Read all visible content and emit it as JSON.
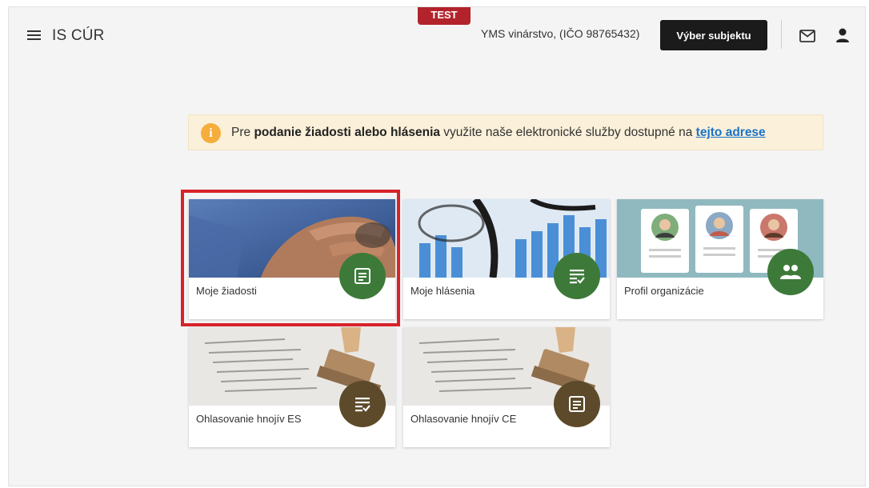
{
  "header": {
    "app_title": "IS CÚR",
    "env_badge": "TEST",
    "organization": "YMS vinárstvo, (IČO 98765432)",
    "select_subject_label": "Výber subjektu",
    "icons": [
      "menu-icon",
      "mail-icon",
      "user-icon"
    ]
  },
  "banner": {
    "text_before": "Pre ",
    "text_bold": "podanie žiadosti alebo hlásenia",
    "text_after": " využite naše elektronické služby dostupné na ",
    "link_text": "tejto adrese",
    "icon": "info-icon"
  },
  "tiles": [
    {
      "label": "Moje žiadosti",
      "icon": "document-icon",
      "fab_color": "#3d7a3a",
      "highlighted": true
    },
    {
      "label": "Moje hlásenia",
      "icon": "checklist-icon",
      "fab_color": "#3d7a3a",
      "highlighted": false
    },
    {
      "label": "Profil organizácie",
      "icon": "people-icon",
      "fab_color": "#3d7a3a",
      "highlighted": false
    },
    {
      "label": "Ohlasovanie hnojív ES",
      "icon": "checklist-icon",
      "fab_color": "#5c4a2a",
      "highlighted": false
    },
    {
      "label": "Ohlasovanie hnojív CE",
      "icon": "document-icon",
      "fab_color": "#5c4a2a",
      "highlighted": false
    }
  ],
  "colors": {
    "highlight_border": "#d7232a",
    "banner_bg": "#fbf0d9",
    "info_icon": "#f5ad3b",
    "link": "#1a73c9"
  }
}
